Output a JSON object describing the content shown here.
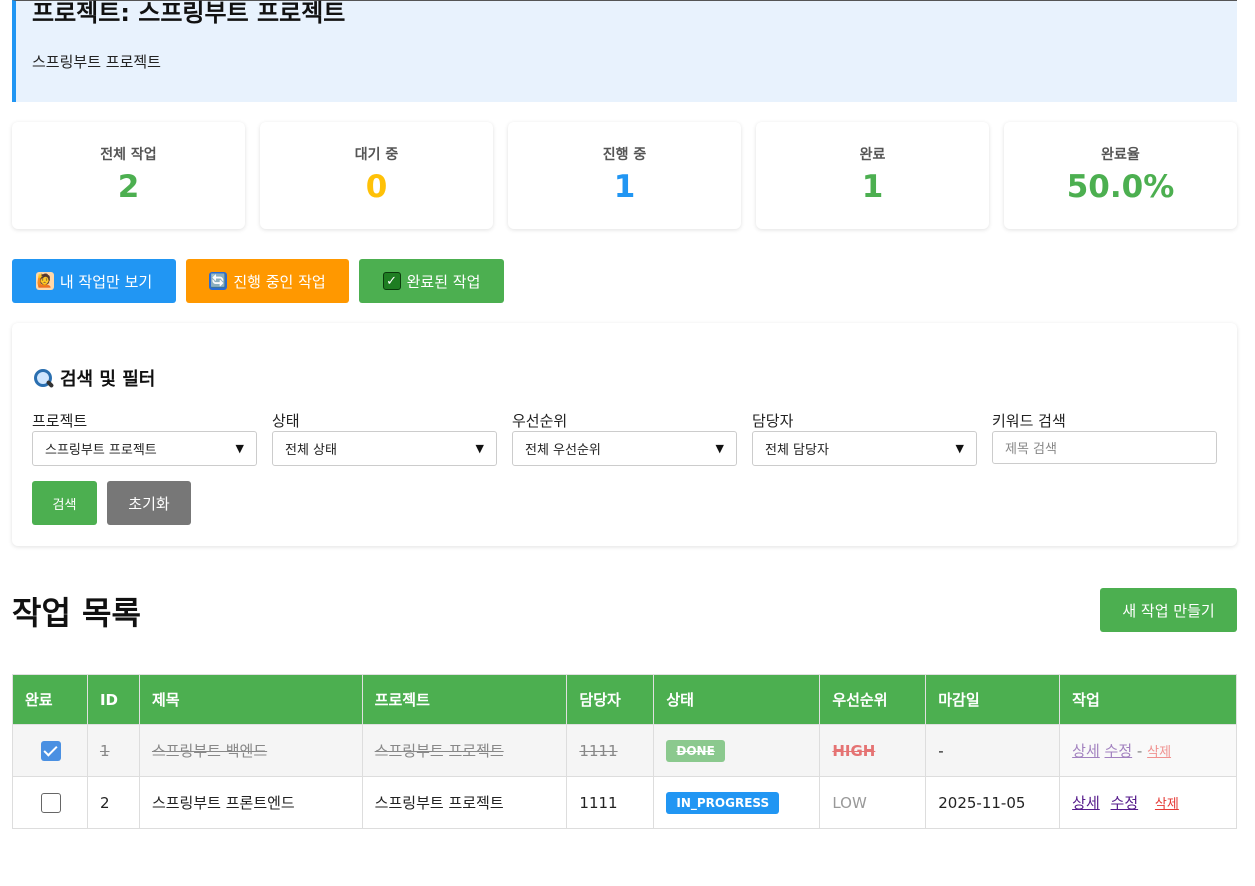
{
  "project": {
    "title": "프로젝트: 스프링부트 프로젝트",
    "description": "스프링부트 프로젝트"
  },
  "stats": [
    {
      "label": "전체 작업",
      "value": "2",
      "color": "#4caf50"
    },
    {
      "label": "대기 중",
      "value": "0",
      "color": "#ffc107"
    },
    {
      "label": "진행 중",
      "value": "1",
      "color": "#2196f3"
    },
    {
      "label": "완료",
      "value": "1",
      "color": "#4caf50"
    },
    {
      "label": "완료율",
      "value": "50.0%",
      "color": "#4caf50"
    }
  ],
  "quick_filters": [
    {
      "label": "내 작업만 보기",
      "icon": "person-raising-hand-icon",
      "glyph": "🙋",
      "color": "#2196f3"
    },
    {
      "label": "진행 중인 작업",
      "icon": "refresh-icon",
      "glyph": "🔄",
      "color": "#ff9800"
    },
    {
      "label": "완료된 작업",
      "icon": "check-mark-icon",
      "glyph": "✓",
      "color": "#4caf50"
    }
  ],
  "search": {
    "title": "검색 및 필터",
    "fields": [
      {
        "label": "프로젝트",
        "value": "스프링부트 프로젝트"
      },
      {
        "label": "상태",
        "value": "전체 상태"
      },
      {
        "label": "우선순위",
        "value": "전체 우선순위"
      },
      {
        "label": "담당자",
        "value": "전체 담당자"
      }
    ],
    "keyword_label": "키워드 검색",
    "keyword_placeholder": "제목 검색",
    "search_button": "검색",
    "reset_button": "초기화"
  },
  "task_list": {
    "title": "작업 목록",
    "new_button": "새 작업 만들기",
    "columns": [
      "완료",
      "ID",
      "제목",
      "프로젝트",
      "담당자",
      "상태",
      "우선순위",
      "마감일",
      "작업"
    ],
    "rows": [
      {
        "done": true,
        "id": "1",
        "title": "스프링부트 백엔드",
        "project": "스프링부트 프로젝트",
        "assignee": "1111",
        "status": "DONE",
        "priority": "HIGH",
        "due": "-",
        "detail": "상세",
        "edit": "수정",
        "sep": "-",
        "delete": "삭제"
      },
      {
        "done": false,
        "id": "2",
        "title": "스프링부트 프론트엔드",
        "project": "스프링부트 프로젝트",
        "assignee": "1111",
        "status": "IN_PROGRESS",
        "priority": "LOW",
        "due": "2025-11-05",
        "detail": "상세",
        "edit": "수정",
        "sep": "",
        "delete": "삭제"
      }
    ]
  },
  "colors": {
    "status_done": "#8bc98e",
    "status_in_progress": "#2196f3",
    "priority_high": "#e53935",
    "priority_low": "#999999"
  }
}
